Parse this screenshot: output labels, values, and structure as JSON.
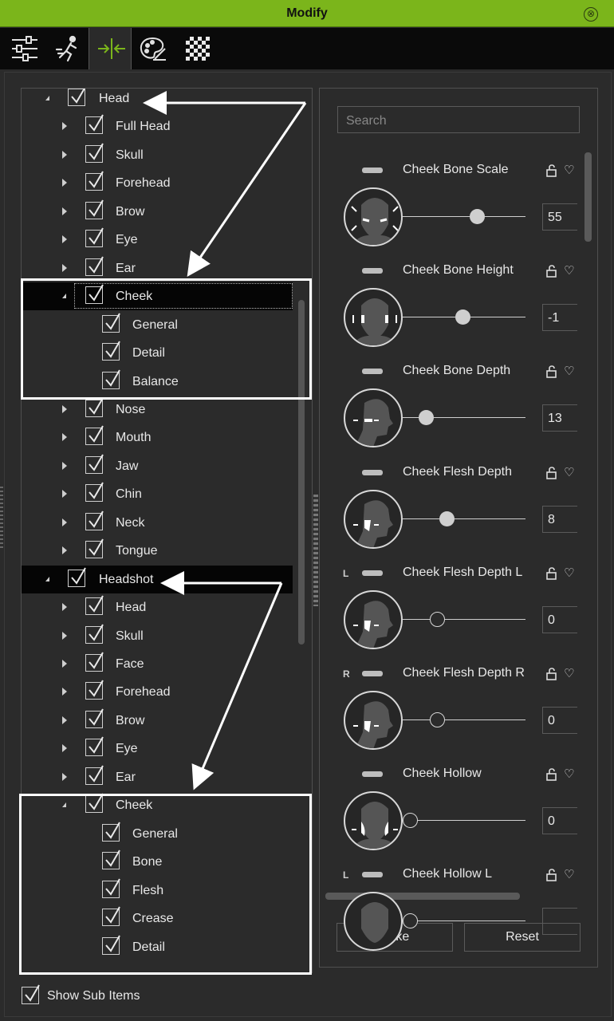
{
  "window": {
    "title": "Modify",
    "close_glyph": "⊗"
  },
  "toolbar": {
    "tools": [
      {
        "icon": "sliders-icon"
      },
      {
        "icon": "motion-icon"
      },
      {
        "icon": "morph-icon",
        "active": true
      },
      {
        "icon": "palette-icon"
      },
      {
        "icon": "checker-icon"
      }
    ]
  },
  "tree": {
    "head_group": {
      "label": "Head",
      "children": [
        "Full Head",
        "Skull",
        "Forehead",
        "Brow",
        "Eye",
        "Ear"
      ],
      "cheek": {
        "label": "Cheek",
        "children": [
          "General",
          "Detail",
          "Balance"
        ]
      },
      "rest": [
        "Nose",
        "Mouth",
        "Jaw",
        "Chin",
        "Neck",
        "Tongue"
      ]
    },
    "headshot_group": {
      "label": "Headshot",
      "children": [
        "Head",
        "Skull",
        "Face",
        "Forehead",
        "Brow",
        "Eye",
        "Ear"
      ],
      "cheek": {
        "label": "Cheek",
        "children": [
          "General",
          "Bone",
          "Flesh",
          "Crease",
          "Detail"
        ]
      }
    }
  },
  "search": {
    "placeholder": "Search"
  },
  "params": [
    {
      "name": "Cheek Bone Scale",
      "value": "55",
      "side": "",
      "level": 0.62,
      "knob": "filled"
    },
    {
      "name": "Cheek Bone Height",
      "value": "-1",
      "side": "",
      "level": 0.49,
      "knob": "filled"
    },
    {
      "name": "Cheek Bone Depth",
      "value": "13",
      "side": "",
      "level": 0.15,
      "knob": "filled"
    },
    {
      "name": "Cheek Flesh Depth",
      "value": "8",
      "side": "",
      "level": 0.34,
      "knob": "filled"
    },
    {
      "name": "Cheek Flesh Depth L",
      "value": "0",
      "side": "L",
      "level": 0.25,
      "knob": "hollow"
    },
    {
      "name": "Cheek Flesh Depth R",
      "value": "0",
      "side": "R",
      "level": 0.25,
      "knob": "hollow"
    },
    {
      "name": "Cheek Hollow",
      "value": "0",
      "side": "",
      "level": 0.0,
      "knob": "hollow"
    },
    {
      "name": "Cheek Hollow L",
      "value": "",
      "side": "L",
      "level": 0.0,
      "knob": "hollow"
    }
  ],
  "buttons": {
    "bake": "Bake",
    "reset": "Reset"
  },
  "footer": {
    "show_sub_items": "Show Sub Items"
  },
  "colors": {
    "accent": "#7bb51b",
    "background": "#2b2b2b",
    "selected_row": "#050505"
  }
}
